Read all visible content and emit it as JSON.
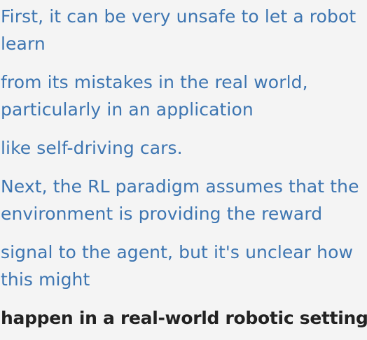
{
  "transcript": {
    "lines": [
      "First, it can be very unsafe to let a robot",
      "learn",
      "from its mistakes in the real world,",
      "particularly in an application",
      "like self-driving cars.",
      "Next, the RL paradigm assumes that the",
      "environment is providing the reward",
      "signal to the agent, but it's unclear how",
      "this might",
      "happen in a real-world robotic setting."
    ],
    "colors": {
      "upcoming_text": "#3d75b1",
      "active_text": "#222222",
      "background": "#f4f4f4"
    }
  }
}
